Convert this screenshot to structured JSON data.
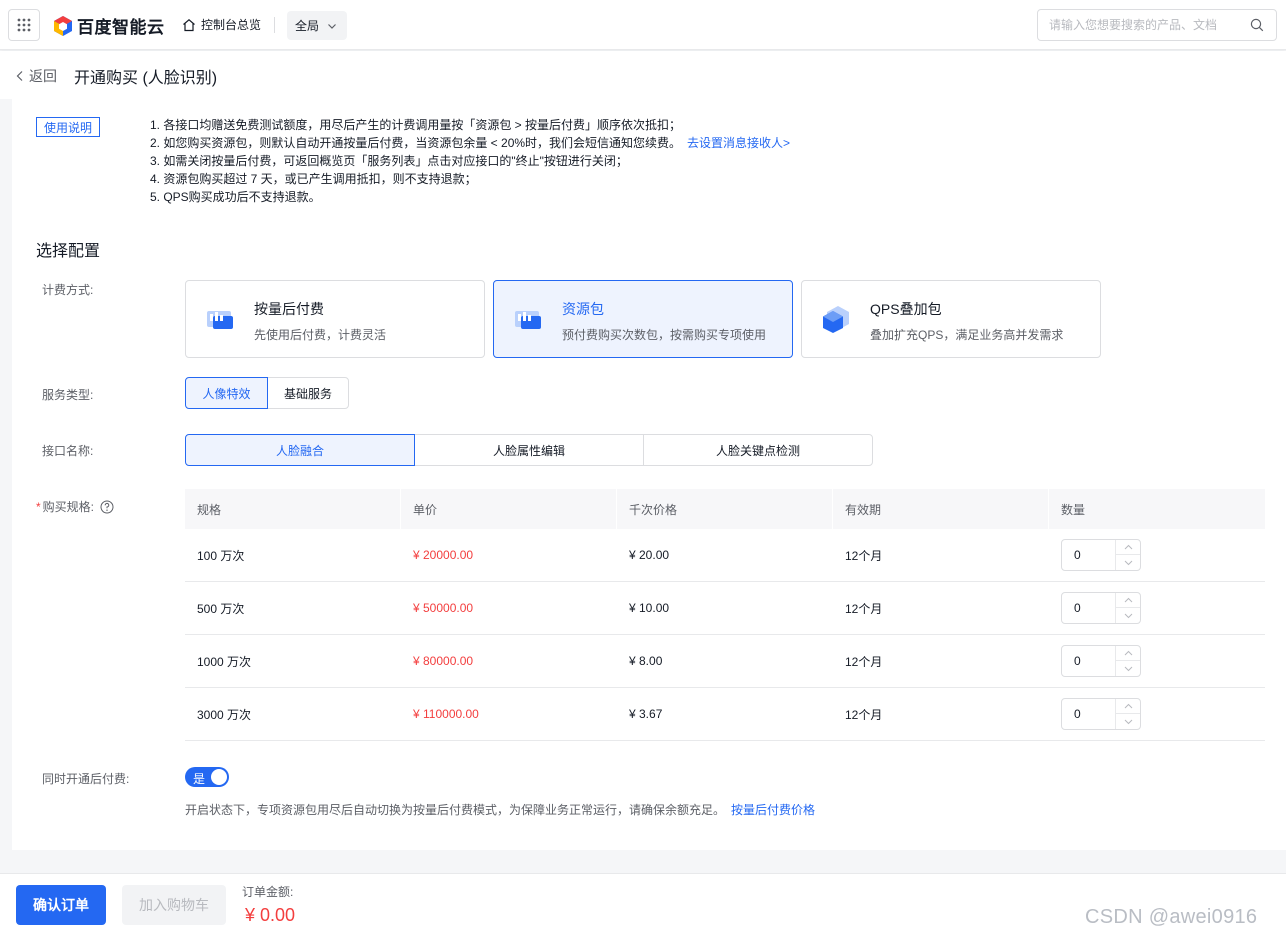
{
  "header": {
    "brand": "百度智能云",
    "console_link": "控制台总览",
    "region": "全局",
    "search_placeholder": "请输入您想要搜索的产品、文档"
  },
  "page": {
    "back": "返回",
    "title": "开通购买 (人脸识别)"
  },
  "usage": {
    "tag": "使用说明",
    "notes": [
      "1. 各接口均赠送免费测试额度，用尽后产生的计费调用量按「资源包 > 按量后付费」顺序依次抵扣；",
      "2. 如您购买资源包，则默认自动开通按量后付费，当资源包余量 < 20%时，我们会短信通知您续费。",
      "3. 如需关闭按量后付费，可返回概览页「服务列表」点击对应接口的\"终止\"按钮进行关闭；",
      "4. 资源包购买超过 7 天，或已产生调用抵扣，则不支持退款；",
      "5. QPS购买成功后不支持退款。"
    ],
    "notify_link": "去设置消息接收人>"
  },
  "config": {
    "section_title": "选择配置",
    "billing_label": "计费方式:",
    "billing_options": [
      {
        "title": "按量后付费",
        "desc": "先使用后付费，计费灵活",
        "selected": false
      },
      {
        "title": "资源包",
        "desc": "预付费购买次数包，按需购买专项使用",
        "selected": true
      },
      {
        "title": "QPS叠加包",
        "desc": "叠加扩充QPS，满足业务高并发需求",
        "selected": false
      }
    ],
    "service_label": "服务类型:",
    "service_options": [
      "人像特效",
      "基础服务"
    ],
    "service_selected": "人像特效",
    "api_label": "接口名称:",
    "api_options": [
      "人脸融合",
      "人脸属性编辑",
      "人脸关键点检测"
    ],
    "api_selected": "人脸融合",
    "spec_label": "购买规格:",
    "spec_required_mark": "*",
    "table": {
      "headers": [
        "规格",
        "单价",
        "千次价格",
        "有效期",
        "数量"
      ],
      "rows": [
        {
          "spec": "100 万次",
          "price": "¥ 20000.00",
          "per_k": "¥ 20.00",
          "validity": "12个月",
          "qty": "0"
        },
        {
          "spec": "500 万次",
          "price": "¥ 50000.00",
          "per_k": "¥ 10.00",
          "validity": "12个月",
          "qty": "0"
        },
        {
          "spec": "1000 万次",
          "price": "¥ 80000.00",
          "per_k": "¥ 8.00",
          "validity": "12个月",
          "qty": "0"
        },
        {
          "spec": "3000 万次",
          "price": "¥ 110000.00",
          "per_k": "¥ 3.67",
          "validity": "12个月",
          "qty": "0"
        }
      ]
    },
    "postpaid_label": "同时开通后付费:",
    "postpaid_toggle": "是",
    "postpaid_desc": "开启状态下，专项资源包用尽后自动切换为按量后付费模式，为保障业务正常运行，请确保余额充足。",
    "postpaid_link": "按量后付费价格"
  },
  "footer": {
    "confirm": "确认订单",
    "add_cart": "加入购物车",
    "amount_label": "订单金额:",
    "amount_value": "¥ 0.00",
    "watermark": "CSDN @awei0916"
  },
  "colors": {
    "primary": "#2468f2",
    "price": "#f33e3e",
    "selected_bg": "#eef3fe"
  }
}
